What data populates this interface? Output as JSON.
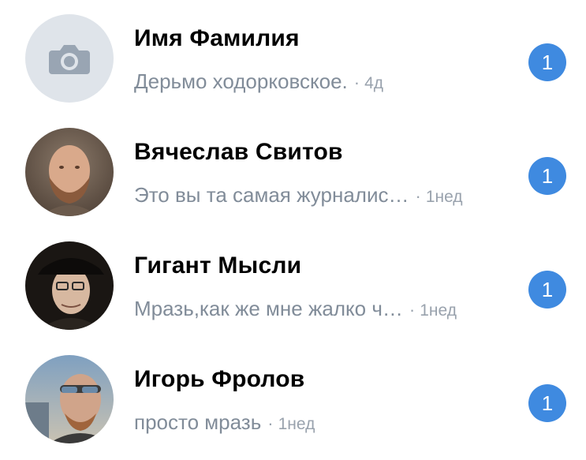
{
  "dialogs": [
    {
      "name": "Имя Фамилия",
      "preview": "Дерьмо ходорковское.",
      "separator": "·",
      "time": "4д",
      "unread": "1",
      "avatar_icon": "camera-placeholder-icon"
    },
    {
      "name": "Вячеслав Свитов",
      "preview": "Это вы та самая журналис…",
      "separator": "·",
      "time": "1нед",
      "unread": "1",
      "avatar_icon": "user-photo"
    },
    {
      "name": "Гигант Мысли",
      "preview": "Мразь,как же мне жалко ч…",
      "separator": "·",
      "time": "1нед",
      "unread": "1",
      "avatar_icon": "user-photo"
    },
    {
      "name": "Игорь Фролов",
      "preview": "просто мразь",
      "separator": "·",
      "time": "1нед",
      "unread": "1",
      "avatar_icon": "user-photo"
    }
  ],
  "colors": {
    "accent": "#3f8ae0",
    "secondary_text": "#818c99",
    "placeholder_bg": "#dfe4ea"
  }
}
